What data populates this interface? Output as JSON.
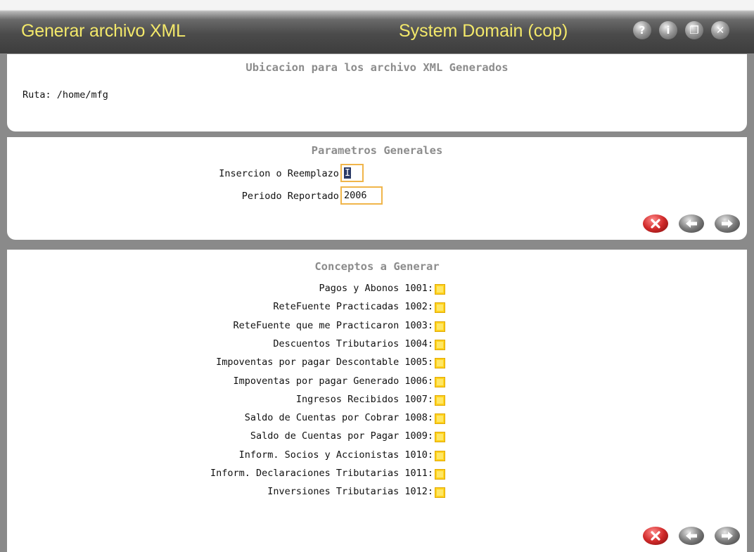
{
  "window": {
    "title": "Generar archivo XML",
    "domain": "System Domain (cop)",
    "buttons": [
      {
        "name": "help-icon",
        "glyph": "?"
      },
      {
        "name": "info-icon",
        "glyph": "i"
      },
      {
        "name": "restore-icon",
        "glyph": "❐"
      },
      {
        "name": "close-icon",
        "glyph": "✕"
      }
    ]
  },
  "location": {
    "title": "Ubicacion para los archivo XML Generados",
    "ruta": "Ruta: /home/mfg"
  },
  "parametros": {
    "title": "Parametros Generales",
    "insercion_label": "Insercion o Reemplazo:",
    "insercion_value": "I",
    "periodo_label": "Periodo Reportado:",
    "periodo_value": "2006"
  },
  "conceptos": {
    "title": "Conceptos a Generar",
    "items": [
      "Pagos y Abonos 1001:",
      "ReteFuente Practicadas 1002:",
      "ReteFuente que me Practicaron 1003:",
      "Descuentos Tributarios 1004:",
      "Impoventas por pagar Descontable 1005:",
      "Impoventas por pagar Generado 1006:",
      "Ingresos Recibidos 1007:",
      "Saldo de Cuentas por Cobrar 1008:",
      "Saldo de Cuentas por Pagar 1009:",
      "Inform. Socios y Accionistas 1010:",
      "Inform. Declaraciones Tributarias 1011:",
      "Inversiones Tributarias 1012:"
    ]
  },
  "colors": {
    "title_text": "#f3e86a",
    "field_border": "#f0b54a",
    "checkbox": "#ffd21e",
    "section_title": "#8c8c8c"
  }
}
